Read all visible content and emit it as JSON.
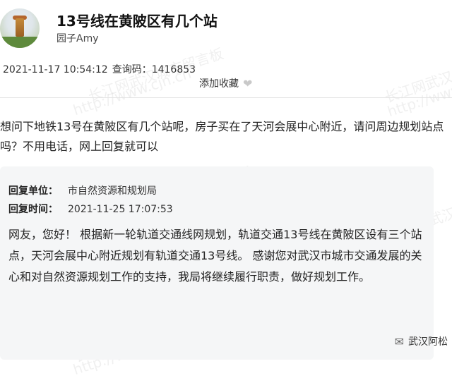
{
  "header": {
    "title": "13号线在黄陂区有几个站",
    "author": "园子Amy"
  },
  "meta": {
    "datetime": "2021-11-17 10:54:12",
    "query_code_label": "查询码：",
    "query_code": "1416853",
    "favorite_label": "添加收藏"
  },
  "question": {
    "text": "想问下地铁13号在黄陂区有几个站呢，房子买在了天河会展中心附近，请问周边规划站点吗？不用电话，网上回复就可以"
  },
  "reply": {
    "unit_label": "回复单位：",
    "unit_value": "市自然资源和规划局",
    "time_label": "回复时间：",
    "time_value": "2021-11-25 17:07:53",
    "body": "网友，您好！ 根据新一轮轨道交通线网规划，轨道交通13号线在黄陂区设有三个站点，天河会展中心附近规划有轨道交通13号线。 感谢您对武汉市城市交通发展的关心和对自然资源规划工作的支持，我局将继续履行职责，做好规划工作。"
  },
  "brand": {
    "label": "武汉阿松"
  },
  "watermarks": {
    "cn_text": "长江网武汉城市留言板",
    "url_text": "http://www.cjn.cn"
  }
}
